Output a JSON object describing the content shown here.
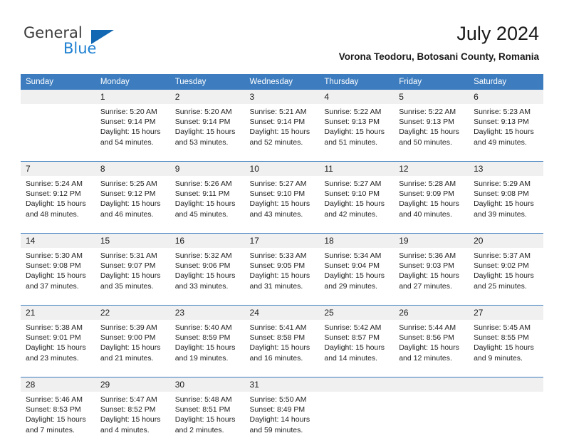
{
  "brand": {
    "name_part1": "General",
    "name_part2": "Blue",
    "triangle_icon": "triangle-icon",
    "accent_color": "#1268b3"
  },
  "header": {
    "title": "July 2024",
    "subtitle": "Vorona Teodoru, Botosani County, Romania"
  },
  "colors": {
    "header_blue": "#3c7cbf",
    "daynum_bg": "#f0f0f0",
    "text": "#1a1a1a"
  },
  "weekday_headers": [
    "Sunday",
    "Monday",
    "Tuesday",
    "Wednesday",
    "Thursday",
    "Friday",
    "Saturday"
  ],
  "weeks": [
    {
      "days": [
        {
          "num": "",
          "sunrise": "",
          "sunset": "",
          "daylight1": "",
          "daylight2": ""
        },
        {
          "num": "1",
          "sunrise": "Sunrise: 5:20 AM",
          "sunset": "Sunset: 9:14 PM",
          "daylight1": "Daylight: 15 hours",
          "daylight2": "and 54 minutes."
        },
        {
          "num": "2",
          "sunrise": "Sunrise: 5:20 AM",
          "sunset": "Sunset: 9:14 PM",
          "daylight1": "Daylight: 15 hours",
          "daylight2": "and 53 minutes."
        },
        {
          "num": "3",
          "sunrise": "Sunrise: 5:21 AM",
          "sunset": "Sunset: 9:14 PM",
          "daylight1": "Daylight: 15 hours",
          "daylight2": "and 52 minutes."
        },
        {
          "num": "4",
          "sunrise": "Sunrise: 5:22 AM",
          "sunset": "Sunset: 9:13 PM",
          "daylight1": "Daylight: 15 hours",
          "daylight2": "and 51 minutes."
        },
        {
          "num": "5",
          "sunrise": "Sunrise: 5:22 AM",
          "sunset": "Sunset: 9:13 PM",
          "daylight1": "Daylight: 15 hours",
          "daylight2": "and 50 minutes."
        },
        {
          "num": "6",
          "sunrise": "Sunrise: 5:23 AM",
          "sunset": "Sunset: 9:13 PM",
          "daylight1": "Daylight: 15 hours",
          "daylight2": "and 49 minutes."
        }
      ]
    },
    {
      "days": [
        {
          "num": "7",
          "sunrise": "Sunrise: 5:24 AM",
          "sunset": "Sunset: 9:12 PM",
          "daylight1": "Daylight: 15 hours",
          "daylight2": "and 48 minutes."
        },
        {
          "num": "8",
          "sunrise": "Sunrise: 5:25 AM",
          "sunset": "Sunset: 9:12 PM",
          "daylight1": "Daylight: 15 hours",
          "daylight2": "and 46 minutes."
        },
        {
          "num": "9",
          "sunrise": "Sunrise: 5:26 AM",
          "sunset": "Sunset: 9:11 PM",
          "daylight1": "Daylight: 15 hours",
          "daylight2": "and 45 minutes."
        },
        {
          "num": "10",
          "sunrise": "Sunrise: 5:27 AM",
          "sunset": "Sunset: 9:10 PM",
          "daylight1": "Daylight: 15 hours",
          "daylight2": "and 43 minutes."
        },
        {
          "num": "11",
          "sunrise": "Sunrise: 5:27 AM",
          "sunset": "Sunset: 9:10 PM",
          "daylight1": "Daylight: 15 hours",
          "daylight2": "and 42 minutes."
        },
        {
          "num": "12",
          "sunrise": "Sunrise: 5:28 AM",
          "sunset": "Sunset: 9:09 PM",
          "daylight1": "Daylight: 15 hours",
          "daylight2": "and 40 minutes."
        },
        {
          "num": "13",
          "sunrise": "Sunrise: 5:29 AM",
          "sunset": "Sunset: 9:08 PM",
          "daylight1": "Daylight: 15 hours",
          "daylight2": "and 39 minutes."
        }
      ]
    },
    {
      "days": [
        {
          "num": "14",
          "sunrise": "Sunrise: 5:30 AM",
          "sunset": "Sunset: 9:08 PM",
          "daylight1": "Daylight: 15 hours",
          "daylight2": "and 37 minutes."
        },
        {
          "num": "15",
          "sunrise": "Sunrise: 5:31 AM",
          "sunset": "Sunset: 9:07 PM",
          "daylight1": "Daylight: 15 hours",
          "daylight2": "and 35 minutes."
        },
        {
          "num": "16",
          "sunrise": "Sunrise: 5:32 AM",
          "sunset": "Sunset: 9:06 PM",
          "daylight1": "Daylight: 15 hours",
          "daylight2": "and 33 minutes."
        },
        {
          "num": "17",
          "sunrise": "Sunrise: 5:33 AM",
          "sunset": "Sunset: 9:05 PM",
          "daylight1": "Daylight: 15 hours",
          "daylight2": "and 31 minutes."
        },
        {
          "num": "18",
          "sunrise": "Sunrise: 5:34 AM",
          "sunset": "Sunset: 9:04 PM",
          "daylight1": "Daylight: 15 hours",
          "daylight2": "and 29 minutes."
        },
        {
          "num": "19",
          "sunrise": "Sunrise: 5:36 AM",
          "sunset": "Sunset: 9:03 PM",
          "daylight1": "Daylight: 15 hours",
          "daylight2": "and 27 minutes."
        },
        {
          "num": "20",
          "sunrise": "Sunrise: 5:37 AM",
          "sunset": "Sunset: 9:02 PM",
          "daylight1": "Daylight: 15 hours",
          "daylight2": "and 25 minutes."
        }
      ]
    },
    {
      "days": [
        {
          "num": "21",
          "sunrise": "Sunrise: 5:38 AM",
          "sunset": "Sunset: 9:01 PM",
          "daylight1": "Daylight: 15 hours",
          "daylight2": "and 23 minutes."
        },
        {
          "num": "22",
          "sunrise": "Sunrise: 5:39 AM",
          "sunset": "Sunset: 9:00 PM",
          "daylight1": "Daylight: 15 hours",
          "daylight2": "and 21 minutes."
        },
        {
          "num": "23",
          "sunrise": "Sunrise: 5:40 AM",
          "sunset": "Sunset: 8:59 PM",
          "daylight1": "Daylight: 15 hours",
          "daylight2": "and 19 minutes."
        },
        {
          "num": "24",
          "sunrise": "Sunrise: 5:41 AM",
          "sunset": "Sunset: 8:58 PM",
          "daylight1": "Daylight: 15 hours",
          "daylight2": "and 16 minutes."
        },
        {
          "num": "25",
          "sunrise": "Sunrise: 5:42 AM",
          "sunset": "Sunset: 8:57 PM",
          "daylight1": "Daylight: 15 hours",
          "daylight2": "and 14 minutes."
        },
        {
          "num": "26",
          "sunrise": "Sunrise: 5:44 AM",
          "sunset": "Sunset: 8:56 PM",
          "daylight1": "Daylight: 15 hours",
          "daylight2": "and 12 minutes."
        },
        {
          "num": "27",
          "sunrise": "Sunrise: 5:45 AM",
          "sunset": "Sunset: 8:55 PM",
          "daylight1": "Daylight: 15 hours",
          "daylight2": "and 9 minutes."
        }
      ]
    },
    {
      "days": [
        {
          "num": "28",
          "sunrise": "Sunrise: 5:46 AM",
          "sunset": "Sunset: 8:53 PM",
          "daylight1": "Daylight: 15 hours",
          "daylight2": "and 7 minutes."
        },
        {
          "num": "29",
          "sunrise": "Sunrise: 5:47 AM",
          "sunset": "Sunset: 8:52 PM",
          "daylight1": "Daylight: 15 hours",
          "daylight2": "and 4 minutes."
        },
        {
          "num": "30",
          "sunrise": "Sunrise: 5:48 AM",
          "sunset": "Sunset: 8:51 PM",
          "daylight1": "Daylight: 15 hours",
          "daylight2": "and 2 minutes."
        },
        {
          "num": "31",
          "sunrise": "Sunrise: 5:50 AM",
          "sunset": "Sunset: 8:49 PM",
          "daylight1": "Daylight: 14 hours",
          "daylight2": "and 59 minutes."
        },
        {
          "num": "",
          "sunrise": "",
          "sunset": "",
          "daylight1": "",
          "daylight2": ""
        },
        {
          "num": "",
          "sunrise": "",
          "sunset": "",
          "daylight1": "",
          "daylight2": ""
        },
        {
          "num": "",
          "sunrise": "",
          "sunset": "",
          "daylight1": "",
          "daylight2": ""
        }
      ]
    }
  ]
}
